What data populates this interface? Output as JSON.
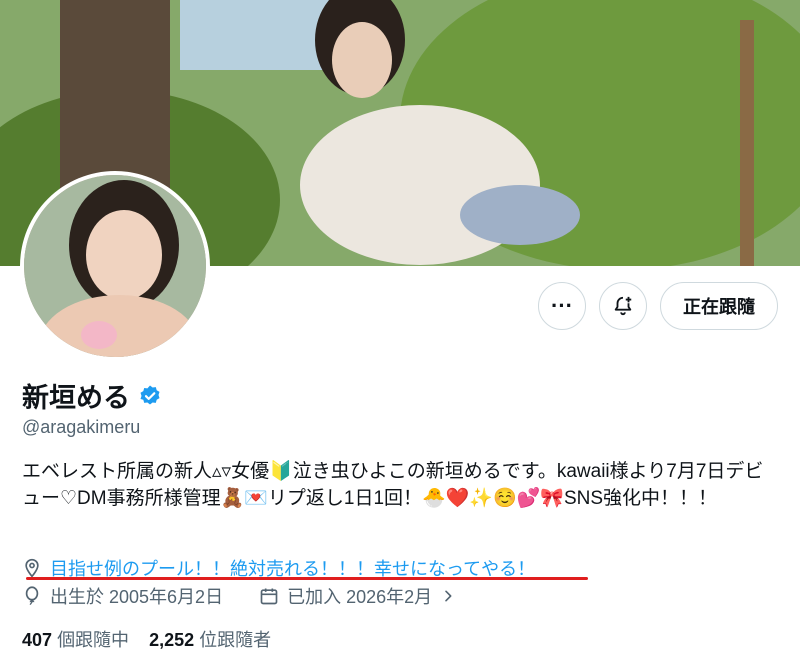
{
  "profile": {
    "name": "新垣める",
    "handle": "@aragakimeru",
    "bio": "エベレスト所属の新人▵▿女優🔰泣き虫ひよこの新垣めるです。kawaii様より7月7日デビュー♡DM事務所様管理🧸💌リプ返し1日1回！🐣❤️✨☺️💕🎀SNS強化中！！！",
    "location": "目指せ例のプール！！絶対売れる！！！幸せになってやる！",
    "birth": "出生於 2005年6月2日",
    "joined": "已加入 2026年2月"
  },
  "actions": {
    "more_label": "···",
    "follow_label": "正在跟隨"
  },
  "stats": {
    "following_count": "407",
    "following_label": "個跟隨中",
    "followers_count": "2,252",
    "followers_label": "位跟隨者"
  },
  "colors": {
    "accent": "#1d9bf0",
    "highlight_underline": "#e01e1e",
    "secondary_text": "#536471"
  }
}
